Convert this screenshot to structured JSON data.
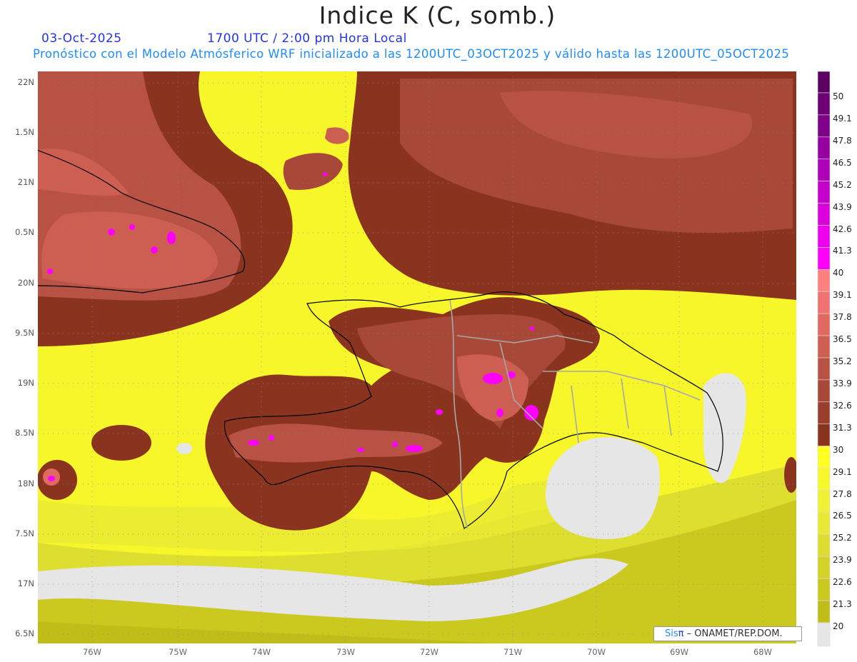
{
  "header": {
    "title": "Indice K (C, somb.)",
    "date": "03-Oct-2025",
    "time": "1700 UTC / 2:00 pm Hora Local",
    "description": "Pronóstico con el Modelo Atmósferico WRF inicializado a las 1200UTC_03OCT2025 y válido hasta las  1200UTC_05OCT2025"
  },
  "axes": {
    "lat_labels": [
      "22N",
      "1.5N",
      "21N",
      "0.5N",
      "20N",
      "9.5N",
      "19N",
      "8.5N",
      "18N",
      "7.5N",
      "17N",
      "6.5N"
    ],
    "lon_labels": [
      "76W",
      "75W",
      "74W",
      "73W",
      "72W",
      "71W",
      "70W",
      "69W",
      "68W"
    ]
  },
  "colorbar": {
    "labels": [
      "50",
      "49.1",
      "47.8",
      "46.5",
      "45.2",
      "43.9",
      "42.6",
      "41.3",
      "40",
      "39.1",
      "37.8",
      "36.5",
      "35.2",
      "33.9",
      "32.6",
      "31.3",
      "30",
      "29.1",
      "27.8",
      "26.5",
      "25.2",
      "23.9",
      "22.6",
      "21.3",
      "20"
    ],
    "colors": [
      "#5c0062",
      "#6c0074",
      "#7e0088",
      "#9600a0",
      "#ae00b8",
      "#c600cc",
      "#dc00dc",
      "#ee00ee",
      "#ff00ff",
      "#ff8080",
      "#f07272",
      "#e06a62",
      "#cc5e52",
      "#b85244",
      "#a84838",
      "#983e2c",
      "#8a3420",
      "#ffff22",
      "#f8f82e",
      "#f0f034",
      "#e8e836",
      "#dedc30",
      "#d4d228",
      "#cbc820",
      "#c0bd18",
      "#e6e6e6"
    ]
  },
  "credit": {
    "brand": "Sis",
    "brand_symbol": "π",
    "org": "– ONAMET/REP.DOM."
  }
}
